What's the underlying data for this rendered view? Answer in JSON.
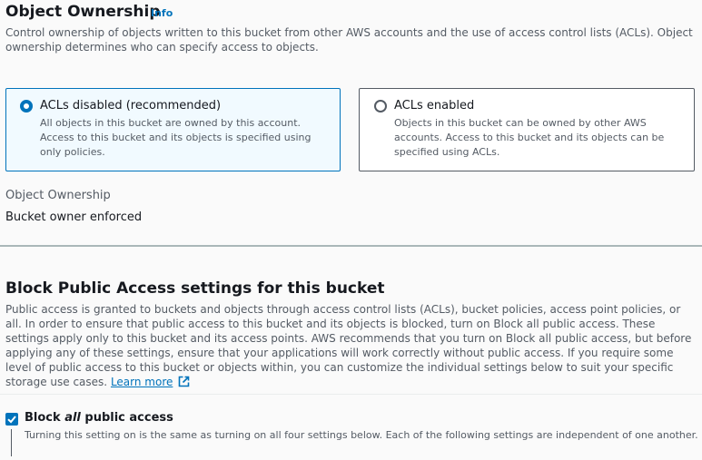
{
  "object_ownership": {
    "title": "Object Ownership",
    "info_label": "Info",
    "description": "Control ownership of objects written to this bucket from other AWS accounts and the use of access control lists (ACLs). Object ownership determines who can specify access to objects.",
    "options": [
      {
        "label": "ACLs disabled (recommended)",
        "description": "All objects in this bucket are owned by this account. Access to this bucket and its objects is specified using only policies.",
        "selected": true
      },
      {
        "label": "ACLs enabled",
        "description": "Objects in this bucket can be owned by other AWS accounts. Access to this bucket and its objects can be specified using ACLs.",
        "selected": false
      }
    ],
    "field_label": "Object Ownership",
    "field_value": "Bucket owner enforced"
  },
  "block_public_access": {
    "title": "Block Public Access settings for this bucket",
    "description": "Public access is granted to buckets and objects through access control lists (ACLs), bucket policies, access point policies, or all. In order to ensure that public access to this bucket and its objects is blocked, turn on Block all public access. These settings apply only to this bucket and its access points. AWS recommends that you turn on Block all public access, but before applying any of these settings, ensure that your applications will work correctly without public access. If you require some level of public access to this bucket or objects within, you can customize the individual settings below to suit your specific storage use cases.",
    "learn_more": "Learn more",
    "block_all": {
      "label_prefix": "Block ",
      "label_emphasis": "all",
      "label_suffix": " public access",
      "checked": true,
      "description": "Turning this setting on is the same as turning on all four settings below. Each of the following settings are independent of one another."
    }
  },
  "colors": {
    "accent": "#0073bb",
    "selected_bg": "#f1faff",
    "text": "#16191f",
    "secondary_text": "#545b64"
  },
  "icons": [
    "radio-selected-icon",
    "radio-unselected-icon",
    "external-link-icon",
    "checkmark-icon"
  ]
}
